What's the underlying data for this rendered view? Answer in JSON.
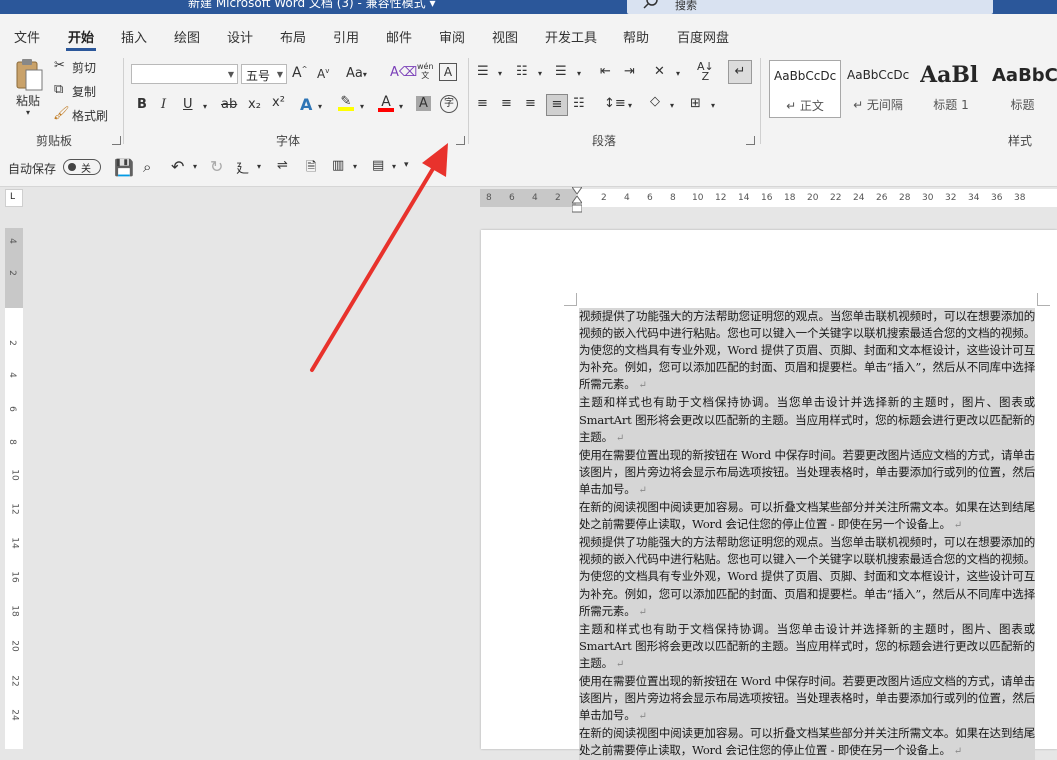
{
  "titlebar": {
    "title": "新建 Microsoft Word 文档 (3) - 兼容性模式 ▾",
    "search_placeholder": "搜索"
  },
  "tabs": [
    "文件",
    "开始",
    "插入",
    "绘图",
    "设计",
    "布局",
    "引用",
    "邮件",
    "审阅",
    "视图",
    "开发工具",
    "帮助",
    "百度网盘"
  ],
  "active_tab": "开始",
  "clipboard": {
    "paste": "粘贴",
    "cut": "剪切",
    "copy": "复制",
    "format_painter": "格式刷",
    "group_label": "剪贴板"
  },
  "font": {
    "font_name": "",
    "font_size": "五号",
    "group_label": "字体",
    "bold": "B",
    "italic": "I",
    "underline": "U",
    "strikethrough": "ab",
    "subscript": "x₂",
    "superscript": "x²",
    "change_case": "Aa",
    "phonetic": "wén",
    "grow": "A",
    "shrink": "A"
  },
  "paragraph": {
    "group_label": "段落"
  },
  "styles": {
    "group_label": "样式",
    "items": [
      {
        "preview": "AaBbCcDc",
        "name": "↵ 正文"
      },
      {
        "preview": "AaBbCcDc",
        "name": "↵ 无间隔"
      },
      {
        "preview": "AaBl",
        "name": "标题 1"
      },
      {
        "preview": "AaBbC",
        "name": "标题"
      }
    ]
  },
  "qat": {
    "autosave_label": "自动保存",
    "autosave_state": "关"
  },
  "ruler": {
    "h_ticks": [
      "8",
      "6",
      "4",
      "2",
      "2",
      "4",
      "6",
      "8",
      "10",
      "12",
      "14",
      "16",
      "18",
      "20",
      "22",
      "24",
      "26",
      "28",
      "30",
      "32",
      "34",
      "36",
      "38"
    ],
    "v_ticks": [
      "4",
      "2",
      "2",
      "4",
      "6",
      "8",
      "10",
      "12",
      "14",
      "16",
      "18",
      "20",
      "22",
      "24"
    ]
  },
  "document": {
    "paragraphs": [
      "视频提供了功能强大的方法帮助您证明您的观点。当您单击联机视频时，可以在想要添加的视频的嵌入代码中进行粘贴。您也可以键入一个关键字以联机搜索最适合您的文档的视频。为使您的文档具有专业外观，Word 提供了页眉、页脚、封面和文本框设计，这些设计可互为补充。例如，您可以添加匹配的封面、页眉和提要栏。单击“插入”，然后从不同库中选择所需元素。",
      "主题和样式也有助于文档保持协调。当您单击设计并选择新的主题时，图片、图表或 SmartArt 图形将会更改以匹配新的主题。当应用样式时，您的标题会进行更改以匹配新的主题。",
      "使用在需要位置出现的新按钮在 Word 中保存时间。若要更改图片适应文档的方式，请单击该图片，图片旁边将会显示布局选项按钮。当处理表格时，单击要添加行或列的位置，然后单击加号。",
      "在新的阅读视图中阅读更加容易。可以折叠文档某些部分并关注所需文本。如果在达到结尾处之前需要停止读取，Word 会记住您的停止位置 - 即使在另一个设备上。",
      "视频提供了功能强大的方法帮助您证明您的观点。当您单击联机视频时，可以在想要添加的视频的嵌入代码中进行粘贴。您也可以键入一个关键字以联机搜索最适合您的文档的视频。为使您的文档具有专业外观，Word 提供了页眉、页脚、封面和文本框设计，这些设计可互为补充。例如，您可以添加匹配的封面、页眉和提要栏。单击“插入”，然后从不同库中选择所需元素。",
      "主题和样式也有助于文档保持协调。当您单击设计并选择新的主题时，图片、图表或 SmartArt 图形将会更改以匹配新的主题。当应用样式时，您的标题会进行更改以匹配新的主题。",
      "使用在需要位置出现的新按钮在 Word 中保存时间。若要更改图片适应文档的方式，请单击该图片，图片旁边将会显示布局选项按钮。当处理表格时，单击要添加行或列的位置，然后单击加号。",
      "在新的阅读视图中阅读更加容易。可以折叠文档某些部分并关注所需文本。如果在达到结尾处之前需要停止读取，Word 会记住您的停止位置 - 即使在另一个设备上。"
    ],
    "paragraph_mark": "↵"
  },
  "colors": {
    "accent": "#2b579a",
    "highlight": "#ffff00",
    "font_color": "#ff0000",
    "arrow": "#e8322c"
  }
}
